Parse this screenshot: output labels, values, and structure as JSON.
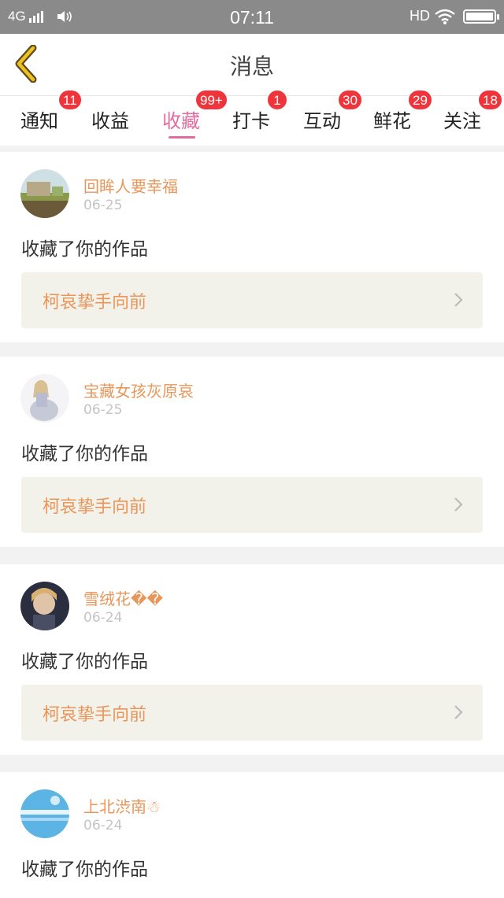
{
  "status_bar": {
    "network": "4G",
    "time": "07:11",
    "hd": "HD"
  },
  "header": {
    "title": "消息",
    "back_icon": "chevron-left-icon"
  },
  "tabs": [
    {
      "label": "通知",
      "badge": "11",
      "active": false
    },
    {
      "label": "收益",
      "badge": "",
      "active": false
    },
    {
      "label": "收藏",
      "badge": "99+",
      "active": true
    },
    {
      "label": "打卡",
      "badge": "1",
      "active": false
    },
    {
      "label": "互动",
      "badge": "30",
      "active": false
    },
    {
      "label": "鲜花",
      "badge": "29",
      "active": false
    },
    {
      "label": "关注",
      "badge": "18",
      "active": false
    }
  ],
  "colors": {
    "accent": "#e36c9e",
    "badge": "#f0343c",
    "username": "#e8965a",
    "back_icon": "#f0c020"
  },
  "feed": [
    {
      "username": "回眸人要幸福",
      "date": "06-25",
      "action": "收藏了你的作品",
      "work_title": "柯哀挚手向前"
    },
    {
      "username": "宝藏女孩灰原哀",
      "date": "06-25",
      "action": "收藏了你的作品",
      "work_title": "柯哀挚手向前"
    },
    {
      "username": "雪绒花��",
      "date": "06-24",
      "action": "收藏了你的作品",
      "work_title": "柯哀挚手向前"
    },
    {
      "username": "上北渋南☃",
      "date": "06-24",
      "action": "收藏了你的作品",
      "work_title": ""
    }
  ]
}
